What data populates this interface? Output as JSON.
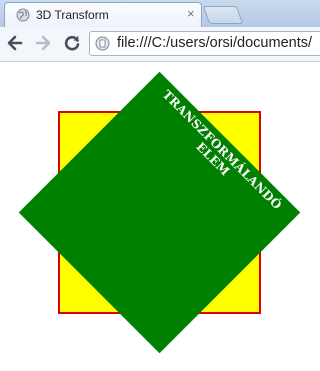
{
  "tab": {
    "title": "3D Transform",
    "close_glyph": "×",
    "favicon": "page-globe-icon"
  },
  "toolbar": {
    "address": "file:///C:/users/orsi/documents/",
    "back_icon": "back-arrow-icon",
    "forward_icon": "forward-arrow-icon",
    "reload_icon": "reload-icon",
    "page_icon": "page-icon"
  },
  "content": {
    "element_label": "TRANSZFORMÁLANDÓ ELEM"
  },
  "colors": {
    "container_bg": "#ffff00",
    "container_border": "#dd0000",
    "element_bg": "#008000",
    "element_text": "#ffffff"
  }
}
